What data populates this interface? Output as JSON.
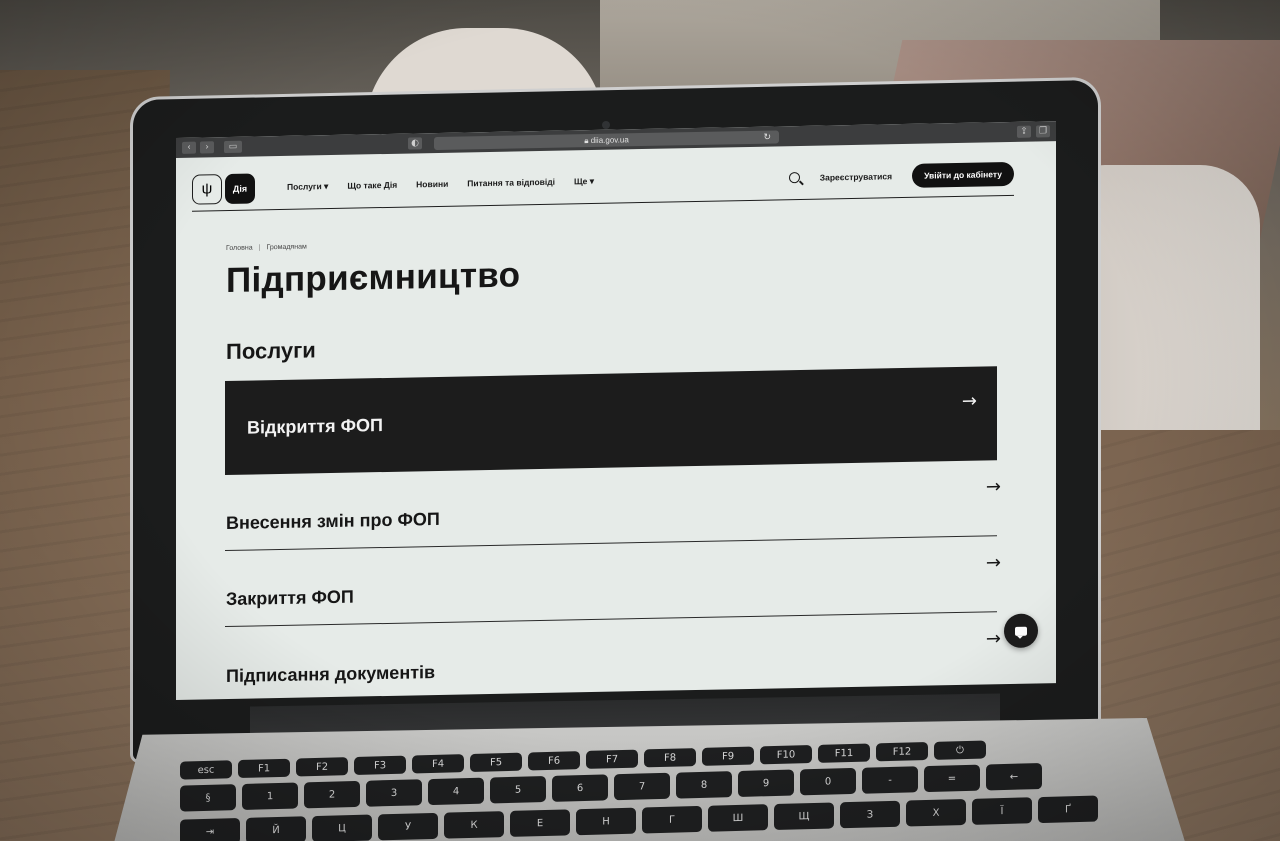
{
  "browser": {
    "url": "diia.gov.ua",
    "back_icon": "chevron-left-icon",
    "forward_icon": "chevron-right-icon",
    "sidebar_icon": "sidebar-icon",
    "shield_icon": "privacy-icon",
    "reload_icon": "reload-icon",
    "share_icon": "share-icon",
    "tabs_icon": "tabs-icon"
  },
  "header": {
    "logo_mark": "trident-icon",
    "logo_text": "Дія",
    "nav": [
      {
        "label": "Послуги ▾"
      },
      {
        "label": "Що таке Дія"
      },
      {
        "label": "Новини"
      },
      {
        "label": "Питання та відповіді"
      },
      {
        "label": "Ще ▾"
      }
    ],
    "register_label": "Зареєструватися",
    "login_label": "Увійти до кабінету"
  },
  "breadcrumb": [
    "Головна",
    "Громадянам"
  ],
  "page_title": "Підприємництво",
  "section_title": "Послуги",
  "services": [
    {
      "label": "Відкриття ФОП",
      "active": true
    },
    {
      "label": "Внесення змін про ФОП"
    },
    {
      "label": "Закриття ФОП"
    },
    {
      "label": "Підписання документів"
    }
  ],
  "arrow_glyph": "→",
  "chat_icon": "chat-icon",
  "keyboard": {
    "row1": [
      "esc",
      "F1",
      "F2",
      "F3",
      "F4",
      "F5",
      "F6",
      "F7",
      "F8",
      "F9",
      "F10",
      "F11",
      "F12",
      "⏻"
    ],
    "row2": [
      "§",
      "1",
      "2",
      "3",
      "4",
      "5",
      "6",
      "7",
      "8",
      "9",
      "0",
      "-",
      "=",
      "←"
    ],
    "row3": [
      "⇥",
      "Й",
      "Ц",
      "У",
      "К",
      "Е",
      "Н",
      "Г",
      "Ш",
      "Щ",
      "З",
      "Х",
      "Ї",
      "Ґ"
    ]
  },
  "colors": {
    "screen_bg": "#e6ebe8",
    "active_item": "#1c1c1c",
    "text": "#161616"
  }
}
